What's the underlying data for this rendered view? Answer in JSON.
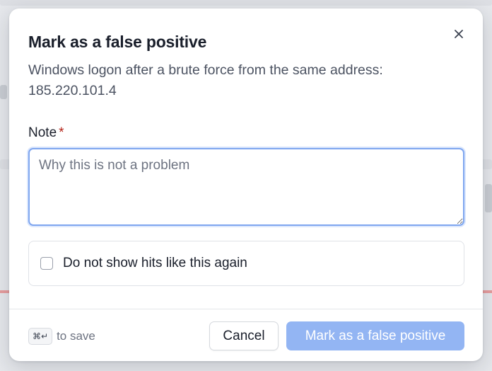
{
  "dialog": {
    "title": "Mark as a false positive",
    "description": "Windows logon after a brute force from the same address: 185.220.101.4",
    "close_icon": "close-icon"
  },
  "form": {
    "note_label": "Note",
    "required_marker": "*",
    "note_placeholder": "Why this is not a problem",
    "note_value": "",
    "checkbox_label": "Do not show hits like this again",
    "checkbox_checked": false
  },
  "footer": {
    "shortcut_keys": "⌘↵",
    "shortcut_hint": "to save",
    "cancel_label": "Cancel",
    "submit_label": "Mark as a false positive",
    "submit_disabled": true
  },
  "colors": {
    "primary_disabled": "#93b5f3",
    "focus_ring": "#7fa6ef",
    "required": "#b42318"
  }
}
